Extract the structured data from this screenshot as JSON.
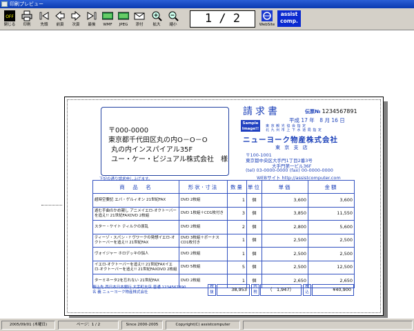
{
  "window": {
    "title": "印刷プレビュー"
  },
  "toolbar": {
    "buttons": [
      {
        "label": "閉じる",
        "icon": "off-icon"
      },
      {
        "label": "印刷",
        "icon": "printer-icon"
      },
      {
        "label": "先頭",
        "icon": "first-icon"
      },
      {
        "label": "前頁",
        "icon": "prev-icon"
      },
      {
        "label": "次頁",
        "icon": "next-icon"
      },
      {
        "label": "最後",
        "icon": "last-icon"
      },
      {
        "label": "WMF",
        "icon": "wmf-icon"
      },
      {
        "label": "JPEG",
        "icon": "jpeg-icon"
      },
      {
        "label": "添付",
        "icon": "attach-icon"
      },
      {
        "label": "拡大",
        "icon": "zoom-in-icon"
      },
      {
        "label": "縮小",
        "icon": "zoom-out-icon"
      }
    ],
    "page_indicator": "1 / 2",
    "website_label": "WebSite",
    "assist_line1": "assist",
    "assist_line2": "comp."
  },
  "invoice": {
    "postal": "〒000-0000",
    "addr1": "東京都千代田区丸の内O－O－O",
    "addr2": "丸の内インスパイアル35F",
    "addr3": "ユー・ケー・ビジュアル株式会社　様",
    "title": "請求書",
    "denpyo_label": "伝票№",
    "denpyo_no": "1234567891",
    "date_label": "平成 17 年　8 月 16 日",
    "sample_line1": "Sample",
    "sample_line2": "Image!!",
    "red_line1": "東 京 観 光 協 会 指 定",
    "red_line2": "北 九 州 市 上 下 水 道 局 指 定",
    "company": "ニューヨーク物産株式会社",
    "branch": "東 京 支 店",
    "zip": "〒100-1001",
    "caddr1": "東京都中央区大手門1丁目2番3号",
    "caddr2": "大手門第一ビル36F",
    "tel": "(tel) 03-0000-0000 (fax) 00-0000-0000",
    "web": "WEBサイト  http://assistcomputer.com",
    "note": "下記の通り請求申し上げます。",
    "headers": {
      "name": "商　品　名",
      "spec": "形状･寸法",
      "qty": "数量",
      "unit": "単位",
      "price": "単価",
      "amount": "金額"
    },
    "rows": [
      {
        "name": "超時空要記 エバ・ゲルィオン 21世紀FAX",
        "spec": "DVD 2枚組",
        "qty": "1",
        "unit": "個",
        "price": "3,600",
        "amount": "3,600"
      },
      {
        "name": "遊む手曲のかめ親し アニメイエロ-オクトーバーを追え!! 21世紀FAXDVD 2枚組",
        "spec": "DVD 1枚組＋CD1枚付き",
        "qty": "3",
        "unit": "個",
        "price": "3,850",
        "amount": "11,550"
      },
      {
        "name": "スター・ケイト ティルクの原乱",
        "spec": "DVD 2枚組",
        "qty": "2",
        "unit": "個",
        "price": "2,800",
        "amount": "5,600"
      },
      {
        "name": "ティーゾ・スパン・? ヴワークの発想イエロ-オクトーバーを追え!! 21世紀FAX",
        "spec": "DVD 3枚組＋ボーナスCD1枚付き",
        "qty": "1",
        "unit": "個",
        "price": "2,500",
        "amount": "2,500"
      },
      {
        "name": "ヴォイジャー ホロデッキの悩人",
        "spec": "DVD 2枚組",
        "qty": "1",
        "unit": "個",
        "price": "2,500",
        "amount": "2,500"
      },
      {
        "name": "イエロ-オクトーバーを追え!! 21世紀FAXイエロ-オクトーバーを追え!! 21世紀FAXDVD 2枚組",
        "spec": "DVD 5枚組",
        "qty": "5",
        "unit": "個",
        "price": "2,500",
        "amount": "12,500"
      },
      {
        "name": "ターミネータ2を忘れない 21世紀FAX",
        "spec": "DVD 2枚組",
        "qty": "1",
        "unit": "個",
        "price": "2,650",
        "amount": "2,650"
      }
    ],
    "bank1": "振込先  西日本日本銀行  大手町支店  普通  1234567890",
    "bank2": "名  義  ニューヨーク物産株式会社",
    "sougaku_label": "税抜",
    "sougaku": "38,953",
    "tax_label": "内税",
    "tax": "（　1,947）",
    "total_label": "税込",
    "total": "¥40,900"
  },
  "status": {
    "date": "2005/09/01 (木曜日)",
    "page": "ページ：1 / 2",
    "since": "Since 2000-2005",
    "copy": "Copyright(C) assistcomputer"
  }
}
